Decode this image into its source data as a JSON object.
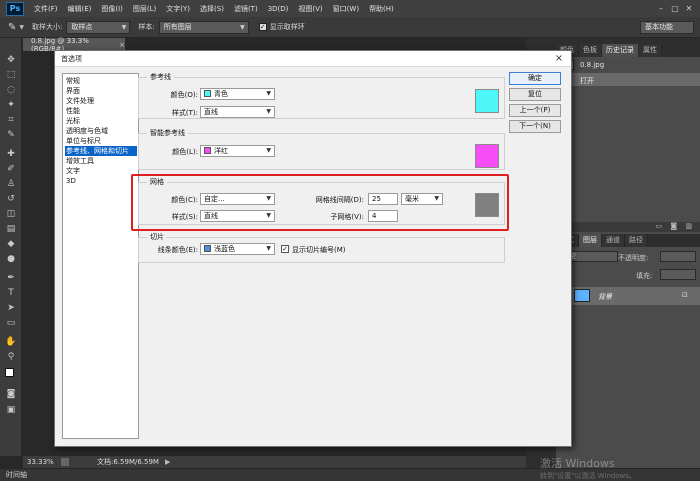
{
  "app": {
    "logo": "Ps"
  },
  "menu": [
    "文件(F)",
    "编辑(E)",
    "图像(I)",
    "图层(L)",
    "文字(Y)",
    "选择(S)",
    "滤镜(T)",
    "3D(D)",
    "视图(V)",
    "窗口(W)",
    "帮助(H)"
  ],
  "window_controls": {
    "minimize": "–",
    "restore": "▢",
    "close": "✕"
  },
  "options": {
    "tool_icon": "eyedropper-icon",
    "sample_size_label": "取样大小:",
    "sample_size_value": "取样点",
    "sample_label": "样本:",
    "sample_value": "所有图层",
    "show_ring_label": "显示取样环",
    "workspace": "基本功能"
  },
  "document": {
    "tab_title": "0.8.jpg @ 33.3%(RGB/8#)",
    "tab_close": "×"
  },
  "status": {
    "zoom": "33.33%",
    "doc_info": "文档:6.59M/6.59M",
    "timeline": "时间轴"
  },
  "right_panels": {
    "top_tabs": [
      "颜色",
      "色板",
      "历史记录",
      "属性"
    ],
    "top_active": "历史记录",
    "history_snapshot": "0.8.jpg",
    "history_item": "打开",
    "bottom_tabs": [
      "样式",
      "图层",
      "通道",
      "路径"
    ],
    "bottom_active": "图层",
    "kind_label": "类型",
    "opacity_label": "不透明度:",
    "fill_label": "填充:",
    "layer_name": "背景"
  },
  "dialog": {
    "title": "首选项",
    "close": "×",
    "nav": [
      "常规",
      "界面",
      "文件处理",
      "性能",
      "光标",
      "透明度与色域",
      "单位与标尺",
      "参考线、网格和切片",
      "增效工具",
      "文字",
      "3D"
    ],
    "nav_selected_index": 7,
    "buttons": {
      "ok": "确定",
      "reset": "复位",
      "prev": "上一个(P)",
      "next": "下一个(N)"
    },
    "guides": {
      "title": "参考线",
      "color_label": "颜色(O):",
      "color_value": "青色",
      "color_hex": "#4df7f7",
      "style_label": "样式(T):",
      "style_value": "直线"
    },
    "smart_guides": {
      "title": "智能参考线",
      "color_label": "颜色(L):",
      "color_value": "洋红",
      "color_hex": "#f74df7"
    },
    "grid": {
      "title": "网格",
      "color_label": "颜色(C):",
      "color_value": "自定...",
      "color_hex": "#808080",
      "style_label": "样式(S):",
      "style_value": "直线",
      "gridline_label": "网格线间隔(D):",
      "gridline_value": "25",
      "unit_value": "毫米",
      "subdiv_label": "子网格(V):",
      "subdiv_value": "4"
    },
    "slices": {
      "title": "切片",
      "line_color_label": "线条颜色(E):",
      "line_color_value": "浅蓝色",
      "line_color_hex": "#4a90e2",
      "show_numbers_label": "显示切片编号(M)",
      "show_numbers_checked": true
    }
  },
  "watermark": {
    "line1": "激活 Windows",
    "line2": "转到\"设置\"以激活 Windows。"
  }
}
